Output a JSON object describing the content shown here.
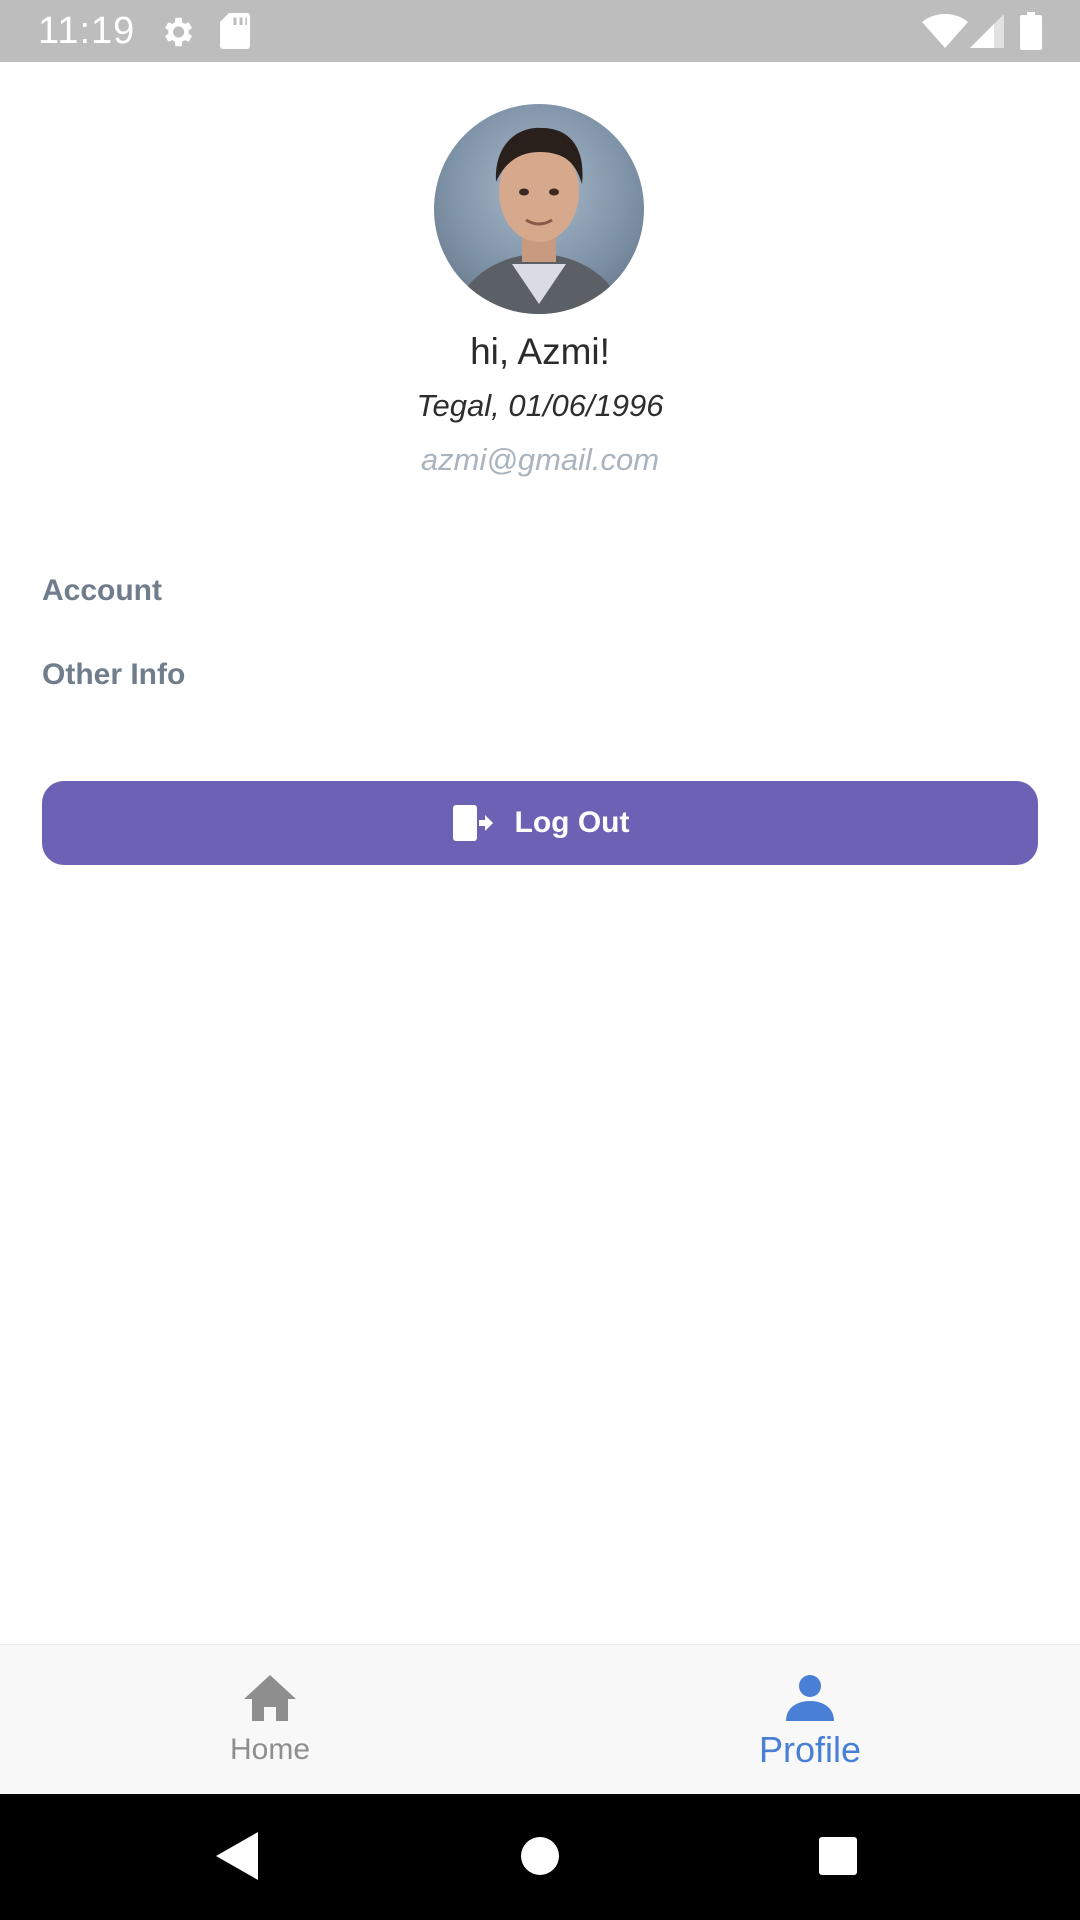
{
  "status_bar": {
    "time": "11:19",
    "icons": [
      "gear-icon",
      "sd-card-icon",
      "wifi-icon",
      "signal-icon",
      "battery-icon"
    ]
  },
  "profile": {
    "greeting": "hi, Azmi!",
    "birth_info": "Tegal, 01/06/1996",
    "email": "azmi@gmail.com"
  },
  "menu": {
    "account": "Account",
    "other_info": "Other Info"
  },
  "logout": {
    "label": "Log Out",
    "icon": "logout-icon",
    "color": "#6b62b6"
  },
  "bottom_nav": {
    "items": [
      {
        "label": "Home",
        "icon": "home-icon",
        "active": false
      },
      {
        "label": "Profile",
        "icon": "person-icon",
        "active": true
      }
    ],
    "active_color": "#4a7fd6",
    "inactive_color": "#8e8e8e"
  },
  "system_nav": {
    "icons": [
      "back-icon",
      "home-circle-icon",
      "recents-icon"
    ]
  }
}
